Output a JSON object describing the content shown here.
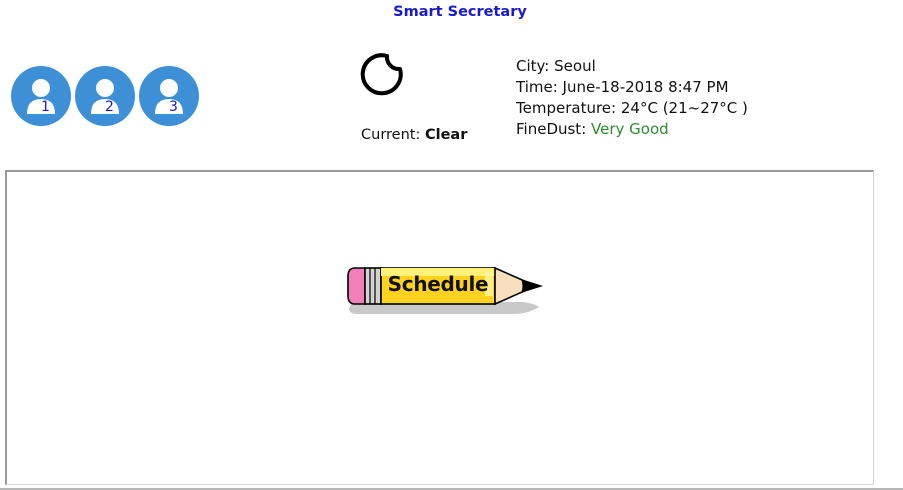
{
  "app": {
    "title": "Smart Secretary"
  },
  "users": [
    {
      "label": "1",
      "icon": "user-icon"
    },
    {
      "label": "2",
      "icon": "user-icon"
    },
    {
      "label": "3",
      "icon": "user-icon"
    }
  ],
  "weather": {
    "icon": "crescent-moon-icon",
    "current_prefix": "Current:",
    "current_value": "Clear"
  },
  "info": {
    "city_label": "City:",
    "city_value": "Seoul",
    "time_label": "Time:",
    "time_value": "June-18-2018 8:47 PM",
    "temp_label": "Temperature:",
    "temp_value": "24°C (21~27°C )",
    "dust_label": "FineDust:",
    "dust_value": "Very Good"
  },
  "schedule": {
    "button_label": "Schedule",
    "icon": "pencil-icon"
  },
  "colors": {
    "title": "#1a1acc",
    "user_button": "#3d8fd6",
    "dust_good": "#2e8b2e"
  }
}
